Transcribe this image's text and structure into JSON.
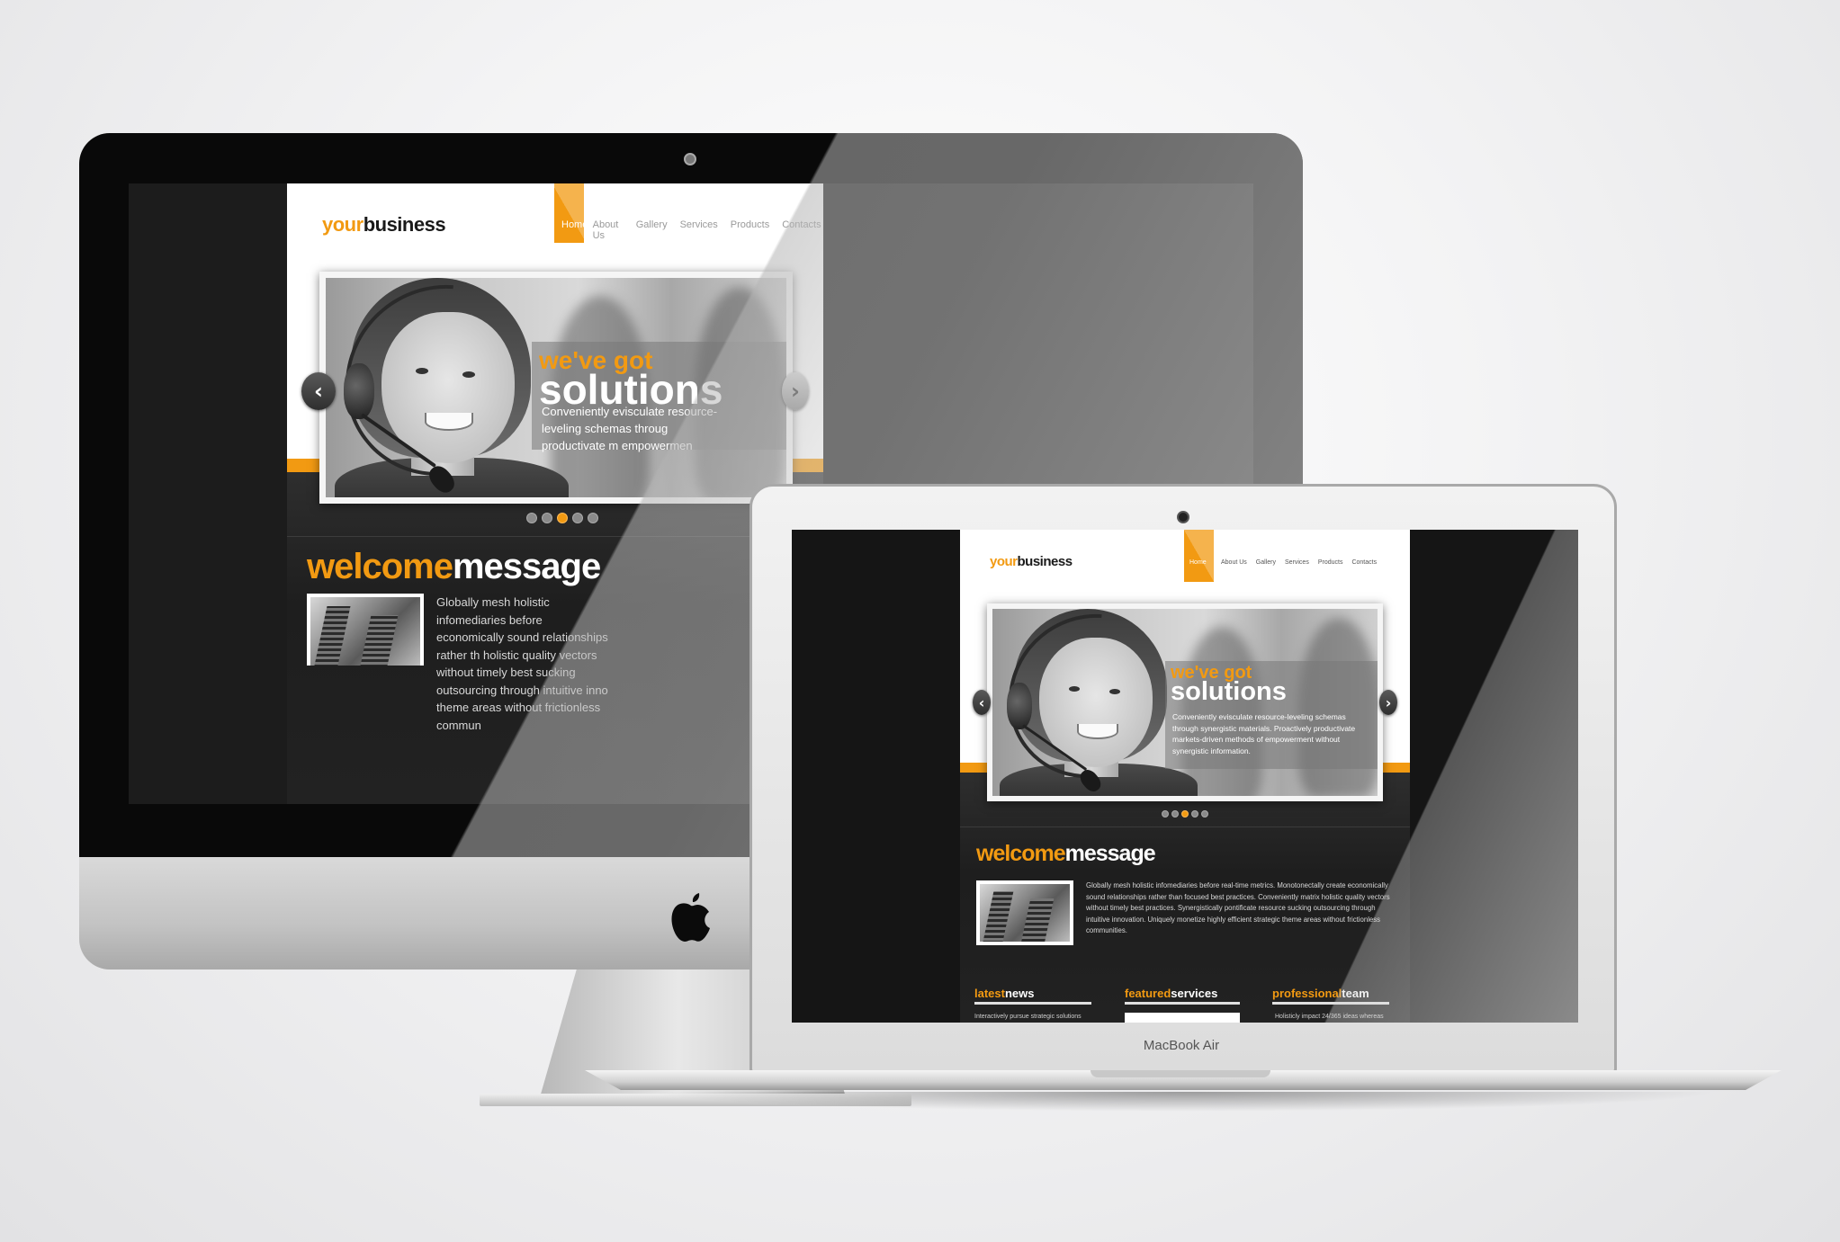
{
  "brand": {
    "logo_accent": "your",
    "logo_main": "business",
    "accent_color": "#f29a12"
  },
  "nav": {
    "home": "Home",
    "about": "About Us",
    "gallery": "Gallery",
    "services": "Services",
    "products": "Products",
    "contacts": "Contacts"
  },
  "slider": {
    "caption_line1": "we've got",
    "caption_line2": "solutions",
    "imac_caption_text": "Conveniently evisculate resource-leveling schemas throug productivate m empowermen",
    "macbook_caption_text": "Conveniently evisculate resource-leveling schemas through synergistic materials. Proactively productivate markets-driven methods of empowerment without synergistic information.",
    "prev_arrow": "‹",
    "next_arrow": "›",
    "dots_count": 5,
    "active_dot": 2
  },
  "welcome": {
    "title_accent": "welcome",
    "title_main": "message",
    "imac_text": "Globally mesh holistic infomediaries before economically sound relationships rather th holistic quality vectors without timely best sucking outsourcing through intuitive inno theme areas without frictionless commun",
    "macbook_text": "Globally mesh holistic infomediaries before real-time metrics. Monotonectally create economically sound relationships rather than focused best practices. Conveniently matrix holistic quality vectors without timely best practices. Synergistically pontificate resource sucking outsourcing through intuitive innovation. Uniquely monetize highly efficient strategic theme areas without frictionless communities."
  },
  "columns": [
    {
      "accent": "latest",
      "main": "news",
      "text": "Interactively pursue strategic solutions"
    },
    {
      "accent": "featured",
      "main": "services",
      "text": ""
    },
    {
      "accent": "professional",
      "main": "team",
      "text": "Holisticly impact 24/365 ideas whereas"
    }
  ],
  "device": {
    "macbook_label": "MacBook Air"
  }
}
